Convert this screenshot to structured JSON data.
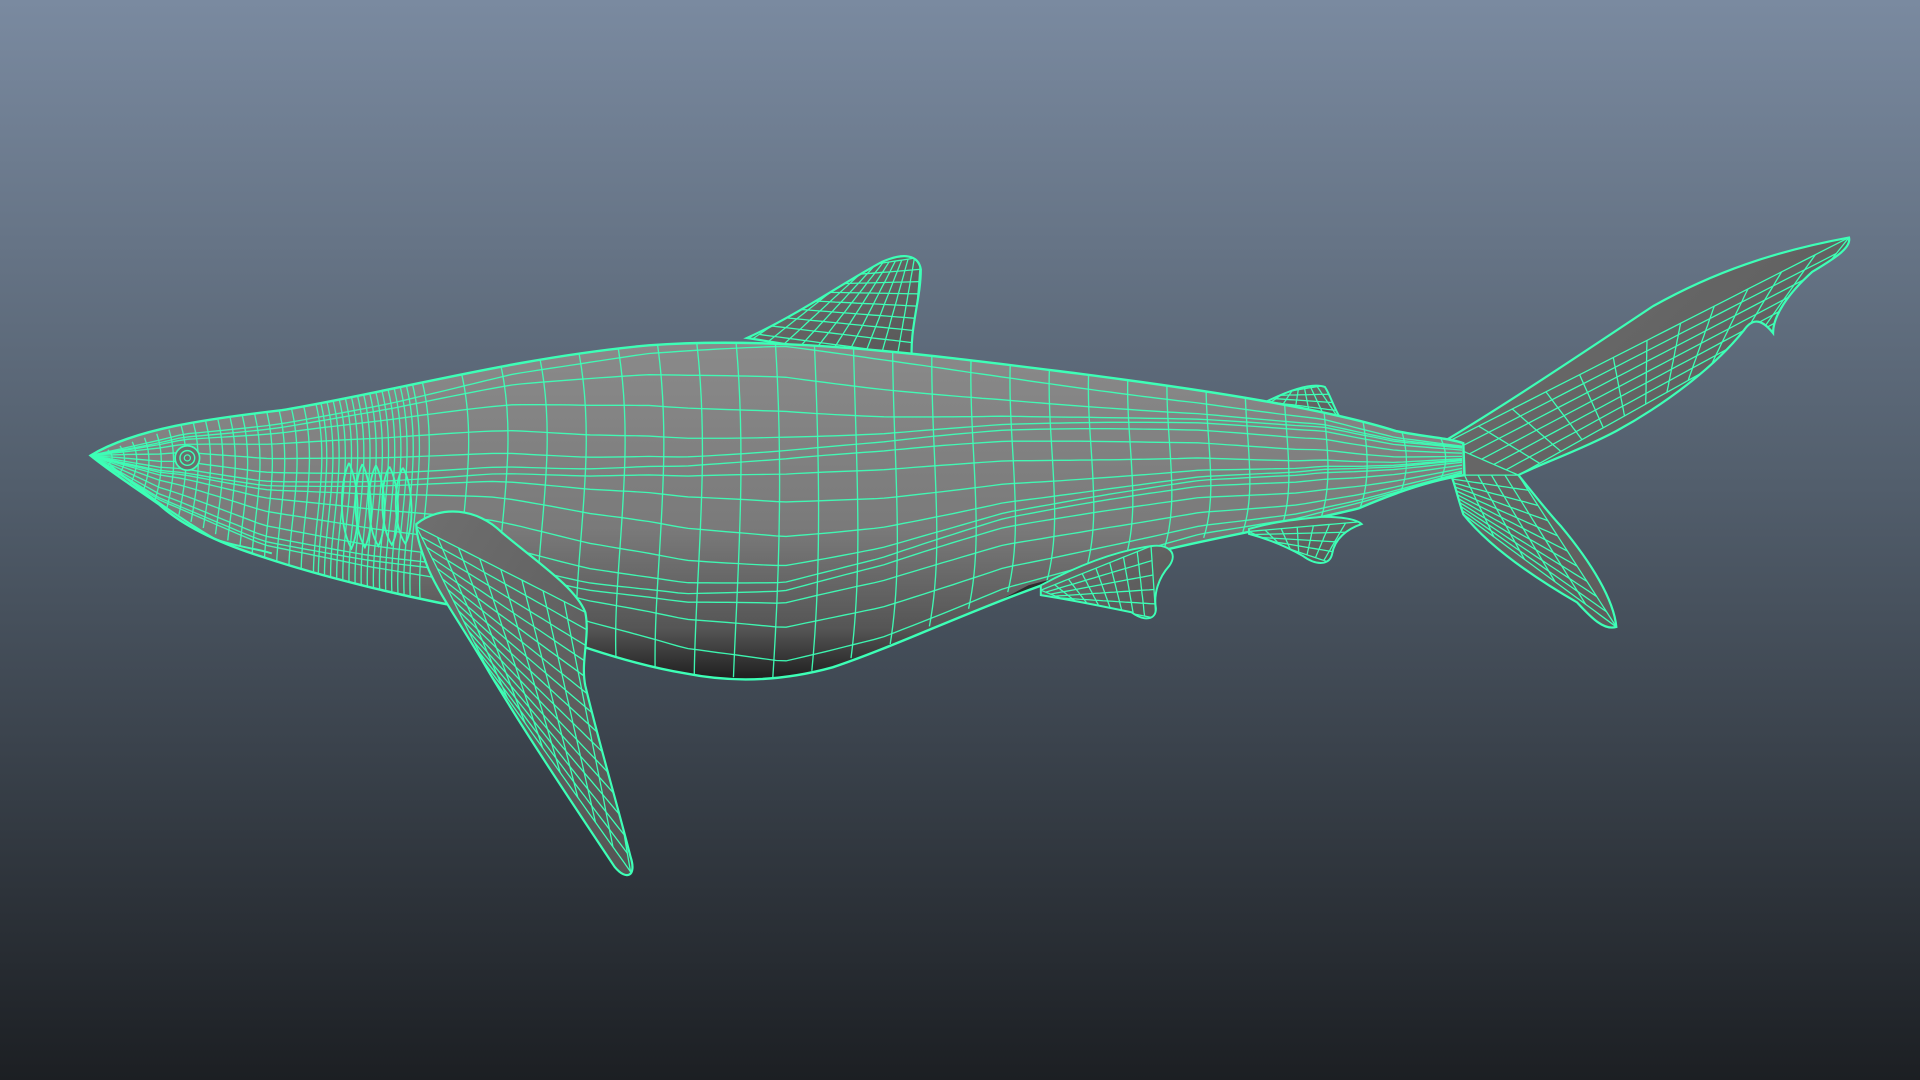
{
  "viewport": {
    "background_top": "#7a8aa0",
    "background_bottom": "#1c1f23"
  },
  "model": {
    "subject": "shark",
    "display_mode": "wireframe-on-shaded",
    "shaded_color": "#7c7c7c",
    "wire_color": "#3dffb6",
    "selected": true
  }
}
